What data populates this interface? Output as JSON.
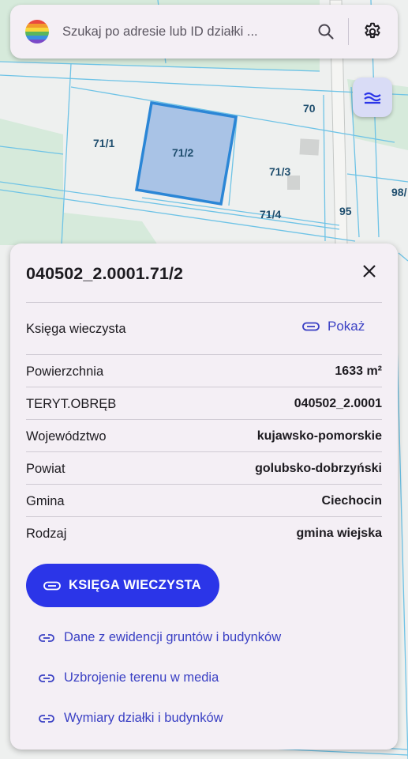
{
  "search": {
    "placeholder": "Szukaj po adresie lub ID działki ..."
  },
  "icons": {
    "logo": "rainbow-stripes-logo",
    "search": "search-icon",
    "settings": "gear-icon",
    "layers": "layers-icon",
    "close": "close-icon",
    "link": "link-icon"
  },
  "map": {
    "parcels": [
      "70",
      "71/1",
      "71/2",
      "71/3",
      "71/4",
      "95",
      "98/"
    ],
    "selected_parcel": "71/2"
  },
  "panel": {
    "title": "040502_2.0001.71/2",
    "rows": [
      {
        "label": "Księga wieczysta",
        "action": "Pokaż"
      },
      {
        "label": "Powierzchnia",
        "value": "1633 m²"
      },
      {
        "label": "TERYT.OBRĘB",
        "value": "040502_2.0001"
      },
      {
        "label": "Województwo",
        "value": "kujawsko-pomorskie"
      },
      {
        "label": "Powiat",
        "value": "golubsko-dobrzyński"
      },
      {
        "label": "Gmina",
        "value": "Ciechocin"
      },
      {
        "label": "Rodzaj",
        "value": "gmina wiejska"
      }
    ],
    "primary_button": "KSIĘGA WIECZYSTA",
    "links": [
      "Dane z ewidencji gruntów i budynków",
      "Uzbrojenie terenu w media",
      "Wymiary działki i budynków"
    ]
  },
  "colors": {
    "accent": "#2b35e8",
    "link": "#3a40c4",
    "parcel_border": "#6ec3e6",
    "selected_fill": "#a9c3e6",
    "selected_border": "#2b86d6",
    "green_area": "#d6ead7"
  }
}
